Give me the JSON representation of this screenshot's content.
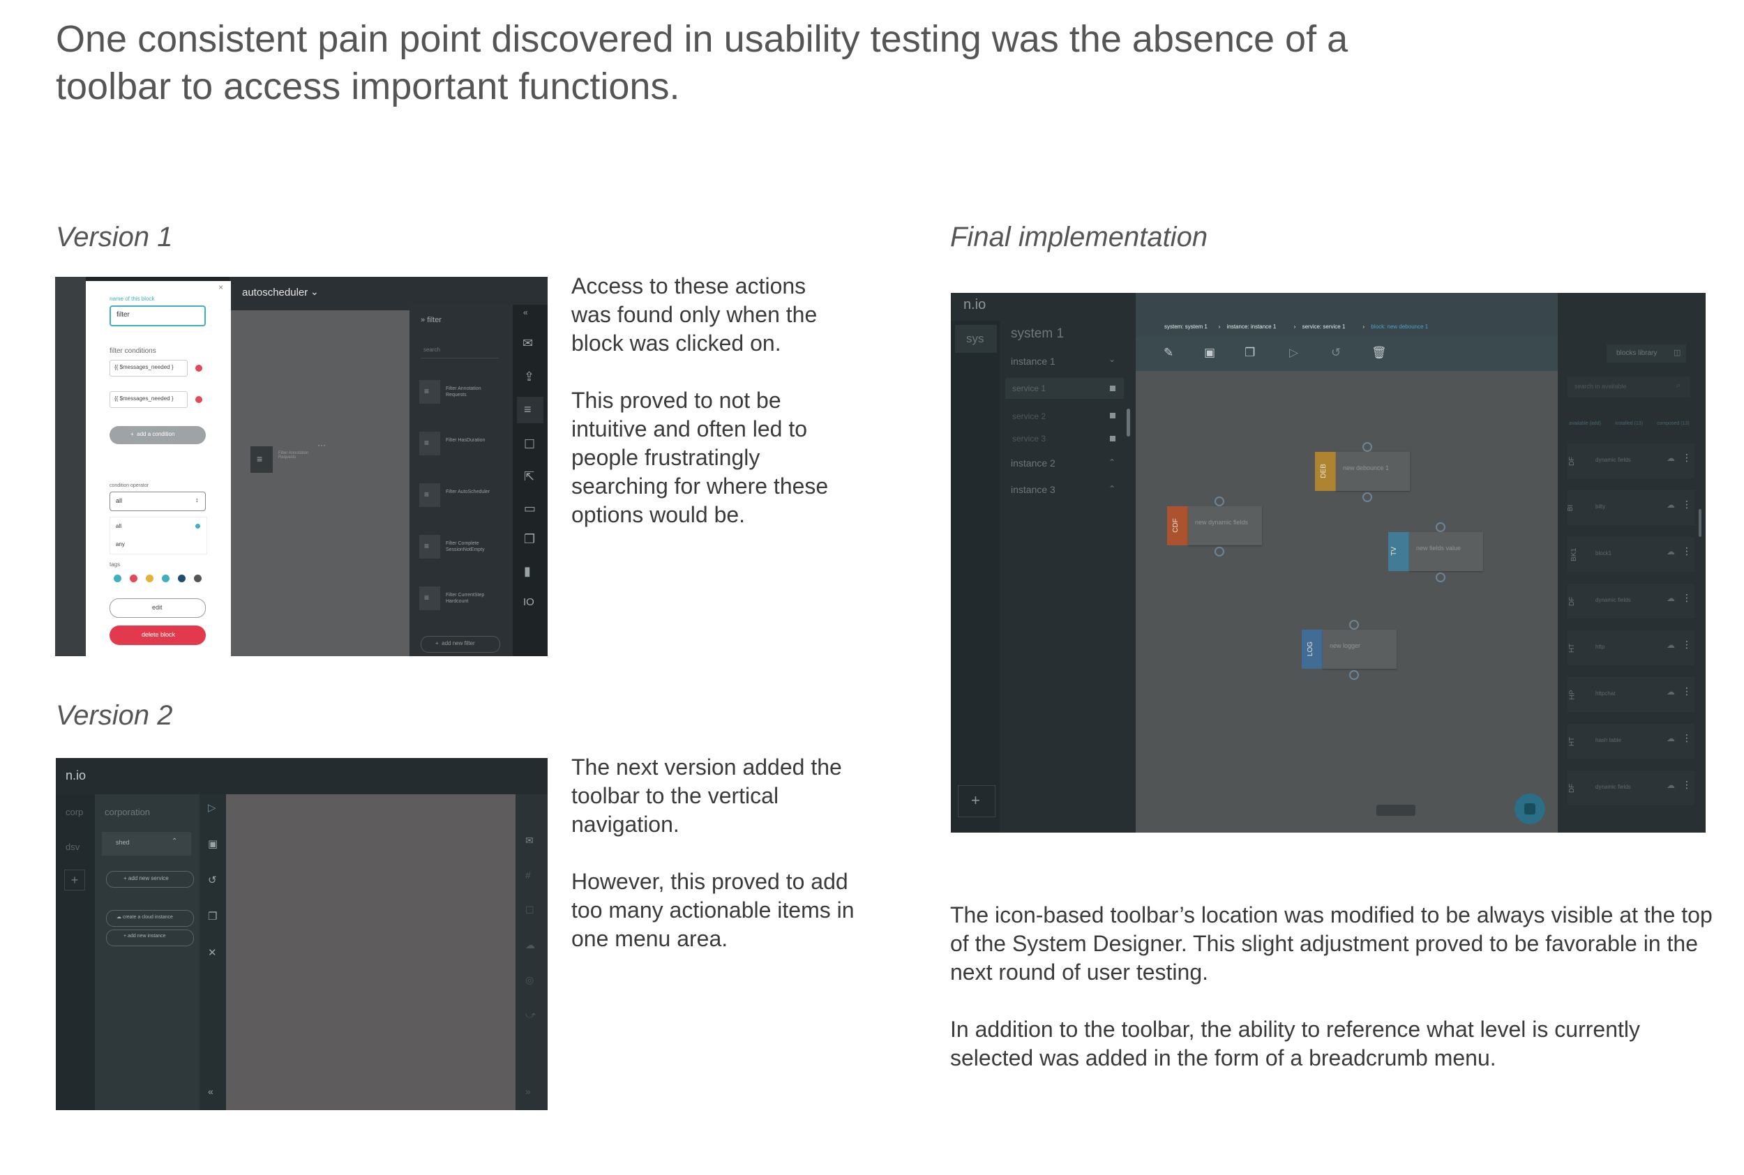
{
  "headline": "One consistent pain point discovered in usability testing was the absence of a toolbar to access important functions.",
  "version1": {
    "caption": "Version 1",
    "paragraphs": [
      "Access to these actions was found only when the block was clicked on.",
      "This proved to not be intuitive and often led to people frustratingly searching for where these options would be."
    ],
    "screenshot": {
      "title": "autoscheduler",
      "panel": {
        "name_label": "name of this block",
        "name_value": "filter",
        "conditions_label": "filter conditions",
        "condition_1": "{{ $messages_needed }",
        "condition_2": "{{ $messages_needed }",
        "add_condition": "add a condition",
        "operator_label": "condition operator",
        "operator_value": "all",
        "option_all": "all",
        "option_any": "any",
        "tags_label": "tags",
        "tag_colors": [
          "#3fb0c0",
          "#e04a5a",
          "#e2b23a",
          "#3fb0c0",
          "#1f4f6e",
          "#555555"
        ],
        "edit": "edit",
        "delete": "delete block"
      },
      "canvas_block": "Filter Annotation Requests",
      "right_panel": {
        "header": "filter",
        "search_placeholder": "search",
        "items": [
          "Filter Annotation Requests",
          "Filter HasDuration",
          "Filter AutoScheduler",
          "Filter Complete SessionNotEmpty",
          "Filter CurrentStep Hardcount"
        ],
        "add_new": "add new filter"
      },
      "rail_last": "IO"
    }
  },
  "version2": {
    "caption": "Version 2",
    "paragraphs": [
      "The next version added the toolbar to the vertical navigation.",
      "However, this proved to add too many actionable items in one menu area."
    ],
    "screenshot": {
      "logo": "n.io",
      "systems": [
        "corp",
        "dsv"
      ],
      "org": "corporation",
      "service": "shed",
      "btn_add_service": "add new service",
      "btn_cloud_instance": "create a cloud instance",
      "btn_add_instance": "add new instance"
    }
  },
  "final": {
    "caption": "Final implementation",
    "paragraphs": [
      "The icon-based toolbar’s location was modified to be always visible at the top of the System Designer. This slight adjustment proved to be favorable in the next round of user testing.",
      "In addition to the toolbar, the ability to reference what level is currently selected was added in the form of a breadcrumb menu."
    ],
    "screenshot": {
      "logo": "n.io",
      "system_tab": "sys",
      "system_name": "system 1",
      "instances": [
        "instance 1",
        "instance 2",
        "instance 3"
      ],
      "services": [
        "service 1",
        "service 2",
        "service 3"
      ],
      "breadcrumb": [
        "system: system 1",
        "instance: instance 1",
        "service: service 1",
        "block: new debounce 1"
      ],
      "blocks_library": "blocks library",
      "library_search": "search in available",
      "library_tabs": [
        "available (add)",
        "installed (13)",
        "composed (13)"
      ],
      "library_items": [
        {
          "code": "DF",
          "name": "dynamic fields"
        },
        {
          "code": "BI",
          "name": "bilty"
        },
        {
          "code": "BK1",
          "name": "block1"
        },
        {
          "code": "DF",
          "name": "dynamic fields"
        },
        {
          "code": "HT",
          "name": "http"
        },
        {
          "code": "HP",
          "name": "httpchat"
        },
        {
          "code": "HT",
          "name": "hash table"
        },
        {
          "code": "DF",
          "name": "dynamic fields"
        }
      ],
      "canvas_blocks": [
        {
          "code": "DEB",
          "name": "new debounce 1",
          "color": "#b8892e"
        },
        {
          "code": "CDF",
          "name": "new dynamic fields",
          "color": "#b5532a"
        },
        {
          "code": "TV",
          "name": "new fields value",
          "color": "#3f7f9c"
        },
        {
          "code": "LOG",
          "name": "new logger",
          "color": "#3f6f9c"
        }
      ]
    }
  }
}
